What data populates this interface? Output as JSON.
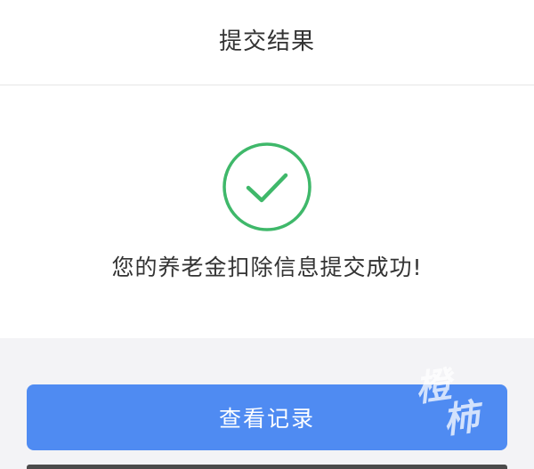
{
  "header": {
    "title": "提交结果"
  },
  "result": {
    "icon": "check-circle-icon",
    "message": "您的养老金扣除信息提交成功!",
    "accent_color": "#3fb86a"
  },
  "actions": {
    "view_records_label": "查看记录",
    "button_color": "#4f8bf2"
  },
  "watermark": {
    "line1": "橙",
    "line2": "柿"
  }
}
